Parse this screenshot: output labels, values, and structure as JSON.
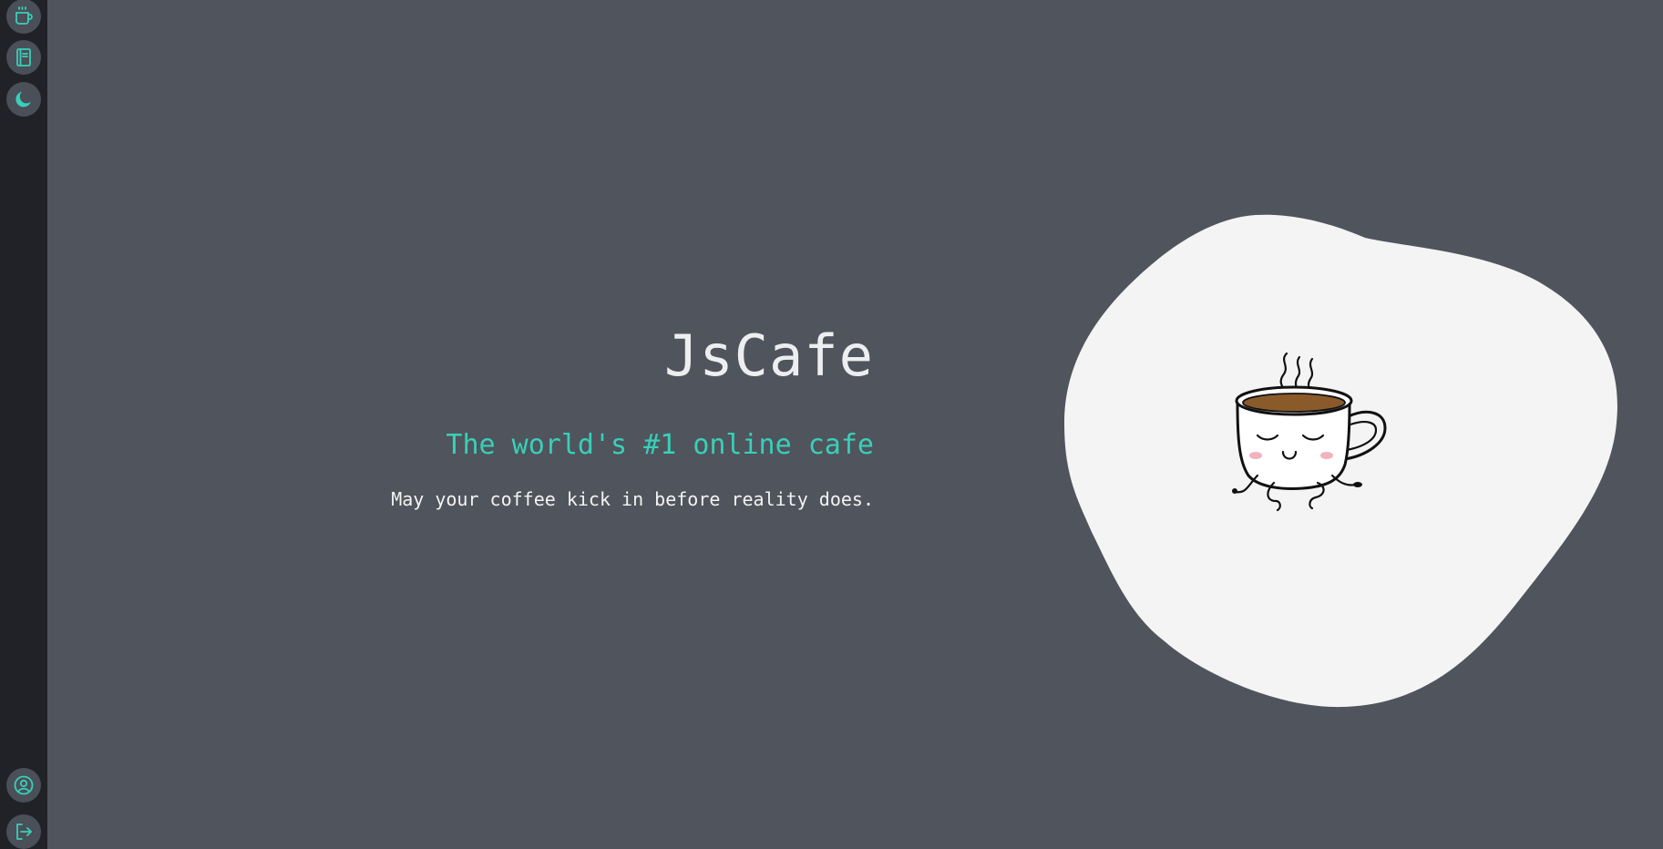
{
  "app": {
    "title": "JsCafe",
    "subtitle": "The world's #1 online cafe",
    "tagline": "May your coffee kick in before reality does."
  },
  "sidebar": {
    "top_items": [
      {
        "icon": "coffee-cup-icon"
      },
      {
        "icon": "menu-book-icon"
      },
      {
        "icon": "dark-mode-moon-icon"
      }
    ],
    "bottom_items": [
      {
        "icon": "user-profile-icon"
      },
      {
        "icon": "logout-icon"
      }
    ]
  },
  "hero_image": {
    "icon": "happy-coffee-cup-illustration"
  },
  "colors": {
    "background": "#50545d",
    "sidebar": "#212227",
    "accent": "#38d0b8",
    "title": "#eceef0",
    "blob": "#f4f4f4",
    "coffee": "#8a5a2b"
  }
}
